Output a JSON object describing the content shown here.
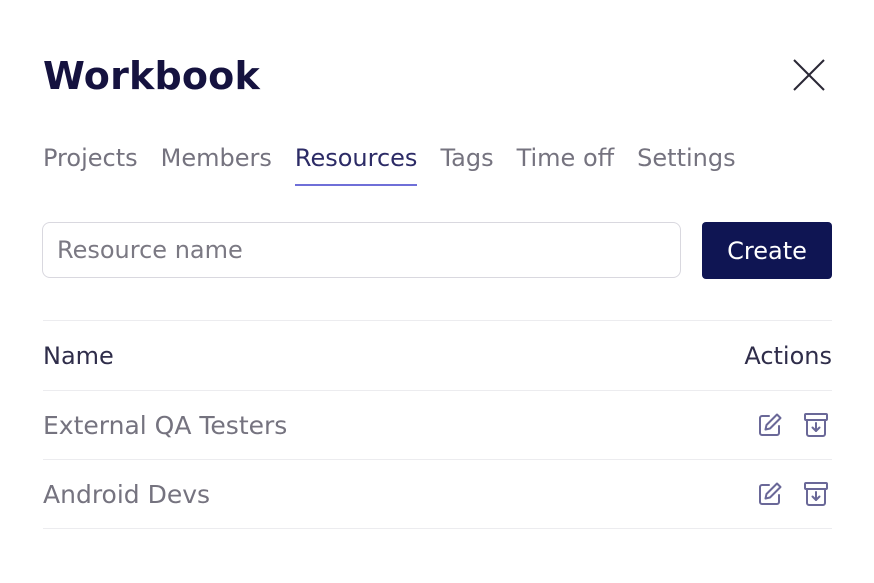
{
  "modal": {
    "title": "Workbook",
    "close_icon": "close-icon"
  },
  "tabs": [
    {
      "label": "Projects",
      "active": false
    },
    {
      "label": "Members",
      "active": false
    },
    {
      "label": "Resources",
      "active": true
    },
    {
      "label": "Tags",
      "active": false
    },
    {
      "label": "Time off",
      "active": false
    },
    {
      "label": "Settings",
      "active": false
    }
  ],
  "form": {
    "placeholder": "Resource name",
    "value": "",
    "create_label": "Create"
  },
  "table": {
    "headers": {
      "name": "Name",
      "actions": "Actions"
    },
    "rows": [
      {
        "name": "External QA Testers",
        "action_icons": [
          "edit-icon",
          "archive-icon"
        ]
      },
      {
        "name": "Android Devs",
        "action_icons": [
          "edit-icon",
          "archive-icon"
        ]
      }
    ]
  },
  "colors": {
    "title": "#15123f",
    "active_tab": "#2c2b66",
    "tab_underline": "#6f6fd8",
    "primary_button": "#0f1553",
    "muted_text": "#75737f",
    "icon": "#6a6898"
  }
}
